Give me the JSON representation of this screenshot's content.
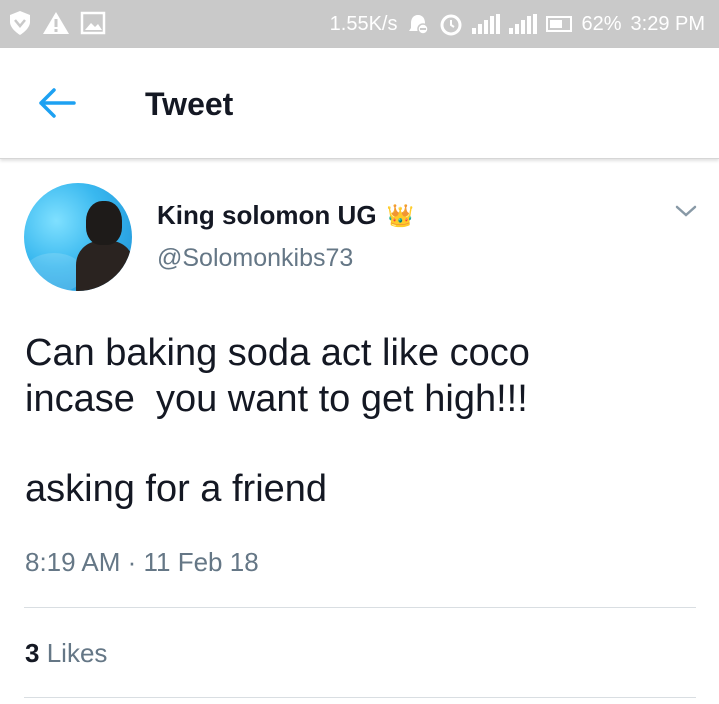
{
  "status_bar": {
    "net_speed": "1.55K/s",
    "battery": "62%",
    "time": "3:29 PM",
    "icons": [
      "shield-icon",
      "warning-icon",
      "image-icon",
      "alarm-off-icon",
      "alarm-icon",
      "signal-icon",
      "signal-e-icon",
      "battery-icon"
    ]
  },
  "header": {
    "title": "Tweet"
  },
  "tweet": {
    "name": "King solomon UG",
    "handle": "@Solomonkibs73",
    "line1": "Can baking soda act like coco",
    "line2": "incase  you want to get high!!!",
    "line3": "asking for a friend",
    "timestamp": "8:19 AM · 11 Feb 18",
    "likes_count": "3",
    "likes_label": "Likes"
  },
  "colors": {
    "text": "#141823",
    "muted": "#657786",
    "accent": "#1da1f2",
    "statusbar": "#c9c9c9"
  }
}
